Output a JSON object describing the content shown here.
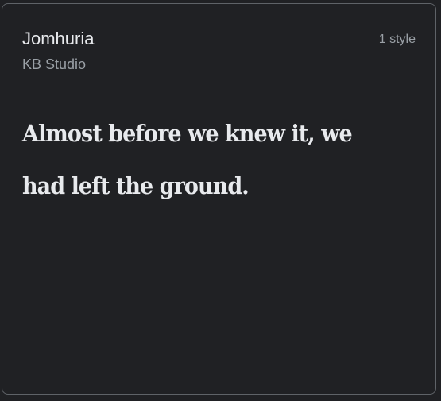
{
  "font_card": {
    "family_name": "Jomhuria",
    "designer": "KB Studio",
    "style_count": "1 style",
    "sample_text": "Almost before we knew it, we had left the ground."
  },
  "colors": {
    "background": "#202124",
    "border": "#5f6368",
    "primary_text": "#e8eaed",
    "secondary_text": "#9aa0a6"
  }
}
